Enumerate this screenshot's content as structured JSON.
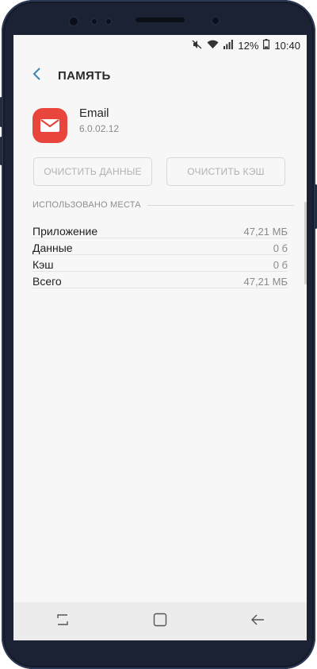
{
  "status_bar": {
    "battery_percent": "12%",
    "time": "10:40",
    "icons": [
      "mute-icon",
      "wifi-icon",
      "signal-icon",
      "battery-icon"
    ]
  },
  "header": {
    "title": "ПАМЯТЬ",
    "back_icon": "back-arrow-icon"
  },
  "app": {
    "name": "Email",
    "version": "6.0.02.12",
    "icon": "email-envelope-icon",
    "icon_color": "#e8453c"
  },
  "actions": {
    "clear_data": "ОЧИСТИТЬ ДАННЫЕ",
    "clear_cache": "ОЧИСТИТЬ КЭШ"
  },
  "storage": {
    "section_title": "ИСПОЛЬЗОВАНО МЕСТА",
    "rows": [
      {
        "label": "Приложение",
        "value": "47,21 МБ"
      },
      {
        "label": "Данные",
        "value": "0 б"
      },
      {
        "label": "Кэш",
        "value": "0 б"
      },
      {
        "label": "Всего",
        "value": "47,21 МБ"
      }
    ]
  },
  "nav_bar": {
    "icons": [
      "recent-apps-icon",
      "home-icon",
      "back-icon"
    ]
  }
}
